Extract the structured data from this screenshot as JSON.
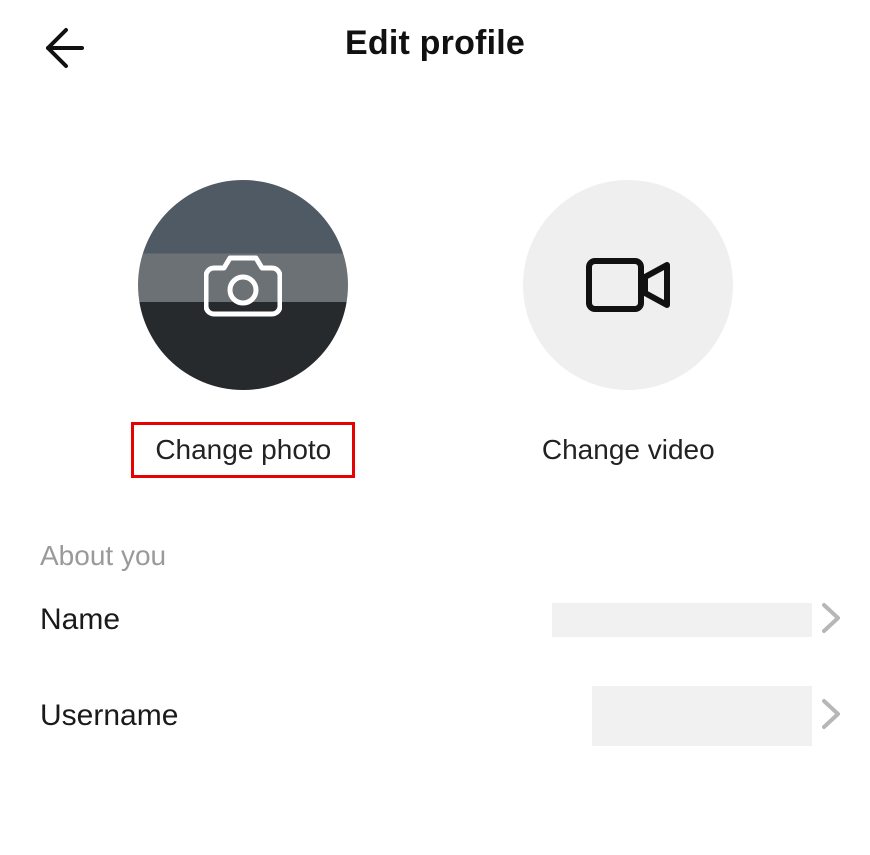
{
  "header": {
    "title": "Edit profile"
  },
  "media": {
    "photo_label": "Change photo",
    "video_label": "Change video"
  },
  "about": {
    "section_title": "About you",
    "name_label": "Name",
    "username_label": "Username",
    "name_value": "",
    "username_value": ""
  }
}
